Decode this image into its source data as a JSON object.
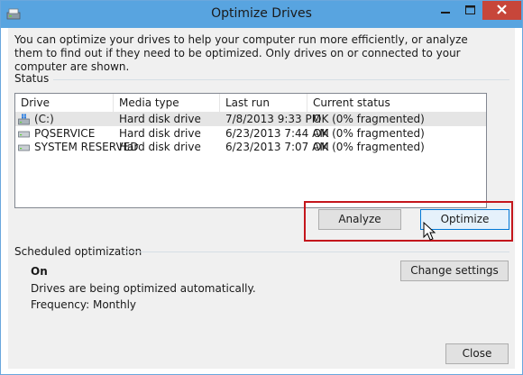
{
  "window": {
    "title": "Optimize Drives",
    "intro_text": "You can optimize your drives to help your computer run more efficiently, or analyze them to find out if they need to be optimized. Only drives on or connected to your computer are shown.",
    "title_bar_buttons": [
      "minimize",
      "maximize",
      "close"
    ],
    "colors": {
      "titlebar": "#58a4e0",
      "close": "#c7463a",
      "highlight_frame": "#c4161c"
    }
  },
  "status": {
    "label": "Status",
    "columns": [
      "Drive",
      "Media type",
      "Last run",
      "Current status"
    ],
    "drives": [
      {
        "drive": "(C:)",
        "media": "Hard disk drive",
        "last_run": "7/8/2013 9:33 PM",
        "status": "OK (0% fragmented)",
        "icon": "windows-drive-icon",
        "selected": true
      },
      {
        "drive": "PQSERVICE",
        "media": "Hard disk drive",
        "last_run": "6/23/2013 7:44 AM",
        "status": "OK (0% fragmented)",
        "icon": "hard-drive-icon",
        "selected": false
      },
      {
        "drive": "SYSTEM RESERVED",
        "media": "Hard disk drive",
        "last_run": "6/23/2013 7:07 AM",
        "status": "OK (0% fragmented)",
        "icon": "hard-drive-icon",
        "selected": false
      }
    ]
  },
  "actions": {
    "analyze": "Analyze",
    "optimize": "Optimize"
  },
  "scheduled": {
    "label": "Scheduled optimization",
    "state": "On",
    "description": "Drives are being optimized automatically.",
    "frequency": "Frequency: Monthly",
    "change_settings": "Change settings"
  },
  "footer": {
    "close": "Close"
  }
}
